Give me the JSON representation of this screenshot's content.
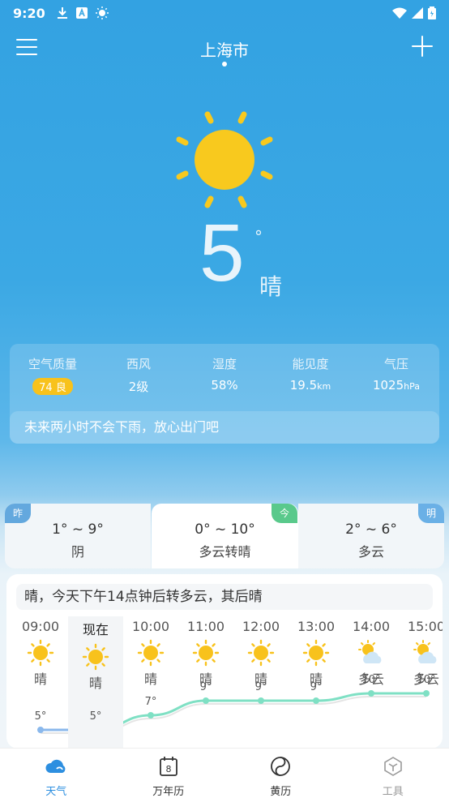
{
  "status": {
    "time": "9:20"
  },
  "header": {
    "city": "上海市"
  },
  "current": {
    "temp": "5",
    "unit": "°",
    "condition": "晴"
  },
  "info": {
    "air_label": "空气质量",
    "air_value": "74 良",
    "wind_label": "西风",
    "wind_value": "2级",
    "humidity_label": "湿度",
    "humidity_value": "58%",
    "visibility_label": "能见度",
    "visibility_value": "19.5",
    "visibility_unit": "km",
    "pressure_label": "气压",
    "pressure_value": "1025",
    "pressure_unit": "hPa",
    "rain_tip": "未来两小时不会下雨，放心出门吧"
  },
  "days": [
    {
      "tag": "昨",
      "range": "1° ~ 9°",
      "condition": "阴"
    },
    {
      "tag": "今",
      "range": "0° ~ 10°",
      "condition": "多云转晴"
    },
    {
      "tag": "明",
      "range": "2° ~ 6°",
      "condition": "多云"
    }
  ],
  "hourly_summary": "晴，今天下午14点钟后转多云，其后晴",
  "hours": [
    {
      "time": "09:00",
      "icon": "sun-icon",
      "condition": "晴",
      "temp": "5°",
      "value": 5
    },
    {
      "time": "现在",
      "icon": "sun-icon",
      "condition": "晴",
      "temp": "5°",
      "value": 5
    },
    {
      "time": "10:00",
      "icon": "sun-icon",
      "condition": "晴",
      "temp": "7°",
      "value": 7
    },
    {
      "time": "11:00",
      "icon": "sun-icon",
      "condition": "晴",
      "temp": "9°",
      "value": 9
    },
    {
      "time": "12:00",
      "icon": "sun-icon",
      "condition": "晴",
      "temp": "9°",
      "value": 9
    },
    {
      "time": "13:00",
      "icon": "sun-icon",
      "condition": "晴",
      "temp": "9°",
      "value": 9
    },
    {
      "time": "14:00",
      "icon": "partly-cloudy-icon",
      "condition": "多云",
      "temp": "10°",
      "value": 10
    },
    {
      "time": "15:00",
      "icon": "partly-cloudy-icon",
      "condition": "多云",
      "temp": "10°",
      "value": 10
    }
  ],
  "nav": [
    {
      "label": "天气",
      "icon": "cloud-icon",
      "active": true
    },
    {
      "label": "万年历",
      "icon": "calendar-icon",
      "active": false
    },
    {
      "label": "黄历",
      "icon": "yinyang-icon",
      "active": false
    },
    {
      "label": "工具",
      "icon": "toolbox-icon",
      "active": false
    }
  ],
  "colors": {
    "accent": "#2d8fe0",
    "sky": "#3ba8e4",
    "sun": "#f8c21c",
    "aqi_good": "#f8c21c",
    "today_tag": "#59c98b",
    "line": "#7fe0c4",
    "line_past": "#8ab8ec"
  }
}
